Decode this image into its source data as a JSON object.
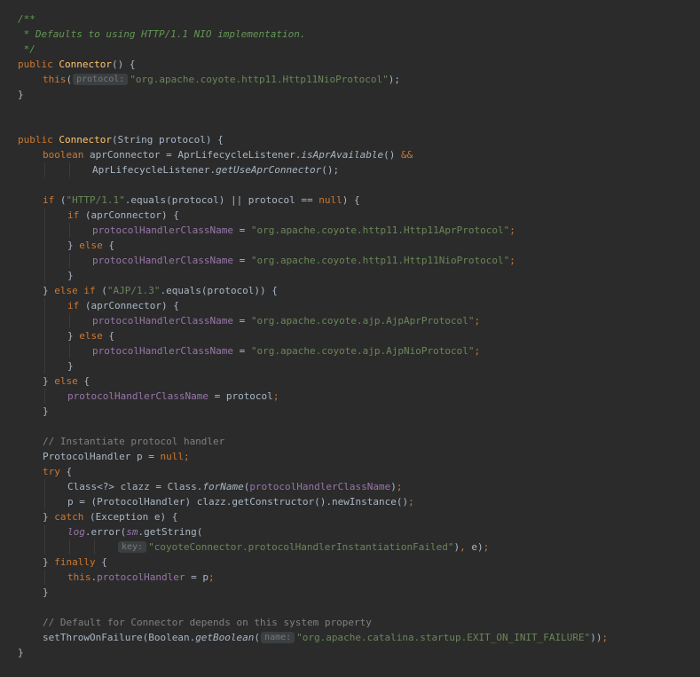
{
  "editor": {
    "lines": [
      {
        "indent": 0,
        "tokens": [
          {
            "t": "/**",
            "c": "doc"
          }
        ]
      },
      {
        "indent": 0,
        "tokens": [
          {
            "t": " * Defaults to using HTTP/1.1 NIO implementation.",
            "c": "doc"
          }
        ]
      },
      {
        "indent": 0,
        "tokens": [
          {
            "t": " */",
            "c": "doc"
          }
        ]
      },
      {
        "indent": 0,
        "tokens": [
          {
            "t": "public ",
            "c": "kw"
          },
          {
            "t": "Connector",
            "c": "fn"
          },
          {
            "t": "() {",
            "c": "plain"
          }
        ]
      },
      {
        "indent": 1,
        "tokens": [
          {
            "t": "this",
            "c": "kw"
          },
          {
            "t": "(",
            "c": "plain"
          },
          {
            "t": "protocol:",
            "c": "hint"
          },
          {
            "t": "\"org.apache.coyote.http11.Http11NioProtocol\"",
            "c": "str"
          },
          {
            "t": ");",
            "c": "plain"
          }
        ]
      },
      {
        "indent": 0,
        "tokens": [
          {
            "t": "}",
            "c": "plain"
          }
        ]
      },
      {
        "indent": 0,
        "tokens": []
      },
      {
        "indent": 0,
        "tokens": []
      },
      {
        "indent": 0,
        "tokens": [
          {
            "t": "public ",
            "c": "kw"
          },
          {
            "t": "Connector",
            "c": "fn"
          },
          {
            "t": "(String protocol) {",
            "c": "plain"
          }
        ]
      },
      {
        "indent": 1,
        "tokens": [
          {
            "t": "boolean ",
            "c": "kw"
          },
          {
            "t": "aprConnector = AprLifecycleListener.",
            "c": "plain"
          },
          {
            "t": "isAprAvailable",
            "c": "italic"
          },
          {
            "t": "() ",
            "c": "plain"
          },
          {
            "t": "&&",
            "c": "kw"
          }
        ]
      },
      {
        "indent": 3,
        "tokens": [
          {
            "t": "AprLifecycleListener.",
            "c": "plain"
          },
          {
            "t": "getUseAprConnector",
            "c": "italic"
          },
          {
            "t": "();",
            "c": "plain"
          }
        ]
      },
      {
        "indent": 0,
        "tokens": []
      },
      {
        "indent": 1,
        "tokens": [
          {
            "t": "if ",
            "c": "kw"
          },
          {
            "t": "(",
            "c": "plain"
          },
          {
            "t": "\"HTTP/1.1\"",
            "c": "str"
          },
          {
            "t": ".equals(protocol) || protocol == ",
            "c": "plain"
          },
          {
            "t": "null",
            "c": "kw"
          },
          {
            "t": ") {",
            "c": "plain"
          }
        ]
      },
      {
        "indent": 2,
        "tokens": [
          {
            "t": "if ",
            "c": "kw"
          },
          {
            "t": "(aprConnector) {",
            "c": "plain"
          }
        ]
      },
      {
        "indent": 3,
        "tokens": [
          {
            "t": "protocolHandlerClassName",
            "c": "field"
          },
          {
            "t": " = ",
            "c": "plain"
          },
          {
            "t": "\"org.apache.coyote.http11.Http11AprProtocol\"",
            "c": "str"
          },
          {
            "t": ";",
            "c": "kw"
          }
        ]
      },
      {
        "indent": 2,
        "tokens": [
          {
            "t": "} ",
            "c": "plain"
          },
          {
            "t": "else ",
            "c": "kw"
          },
          {
            "t": "{",
            "c": "plain"
          }
        ]
      },
      {
        "indent": 3,
        "tokens": [
          {
            "t": "protocolHandlerClassName",
            "c": "field"
          },
          {
            "t": " = ",
            "c": "plain"
          },
          {
            "t": "\"org.apache.coyote.http11.Http11NioProtocol\"",
            "c": "str"
          },
          {
            "t": ";",
            "c": "kw"
          }
        ]
      },
      {
        "indent": 2,
        "tokens": [
          {
            "t": "}",
            "c": "plain"
          }
        ]
      },
      {
        "indent": 1,
        "tokens": [
          {
            "t": "} ",
            "c": "plain"
          },
          {
            "t": "else if ",
            "c": "kw"
          },
          {
            "t": "(",
            "c": "plain"
          },
          {
            "t": "\"AJP/1.3\"",
            "c": "str"
          },
          {
            "t": ".equals(protocol)) {",
            "c": "plain"
          }
        ]
      },
      {
        "indent": 2,
        "tokens": [
          {
            "t": "if ",
            "c": "kw"
          },
          {
            "t": "(aprConnector) {",
            "c": "plain"
          }
        ]
      },
      {
        "indent": 3,
        "tokens": [
          {
            "t": "protocolHandlerClassName",
            "c": "field"
          },
          {
            "t": " = ",
            "c": "plain"
          },
          {
            "t": "\"org.apache.coyote.ajp.AjpAprProtocol\"",
            "c": "str"
          },
          {
            "t": ";",
            "c": "kw"
          }
        ]
      },
      {
        "indent": 2,
        "tokens": [
          {
            "t": "} ",
            "c": "plain"
          },
          {
            "t": "else ",
            "c": "kw"
          },
          {
            "t": "{",
            "c": "plain"
          }
        ]
      },
      {
        "indent": 3,
        "tokens": [
          {
            "t": "protocolHandlerClassName",
            "c": "field"
          },
          {
            "t": " = ",
            "c": "plain"
          },
          {
            "t": "\"org.apache.coyote.ajp.AjpNioProtocol\"",
            "c": "str"
          },
          {
            "t": ";",
            "c": "kw"
          }
        ]
      },
      {
        "indent": 2,
        "tokens": [
          {
            "t": "}",
            "c": "plain"
          }
        ]
      },
      {
        "indent": 1,
        "tokens": [
          {
            "t": "} ",
            "c": "plain"
          },
          {
            "t": "else ",
            "c": "kw"
          },
          {
            "t": "{",
            "c": "plain"
          }
        ]
      },
      {
        "indent": 2,
        "tokens": [
          {
            "t": "protocolHandlerClassName",
            "c": "field"
          },
          {
            "t": " = protocol",
            "c": "plain"
          },
          {
            "t": ";",
            "c": "kw"
          }
        ]
      },
      {
        "indent": 1,
        "tokens": [
          {
            "t": "}",
            "c": "plain"
          }
        ]
      },
      {
        "indent": 0,
        "tokens": []
      },
      {
        "indent": 1,
        "tokens": [
          {
            "t": "// Instantiate protocol handler",
            "c": "comment"
          }
        ]
      },
      {
        "indent": 1,
        "tokens": [
          {
            "t": "ProtocolHandler p = ",
            "c": "plain"
          },
          {
            "t": "null;",
            "c": "kw"
          }
        ]
      },
      {
        "indent": 1,
        "tokens": [
          {
            "t": "try ",
            "c": "kw"
          },
          {
            "t": "{",
            "c": "plain"
          }
        ]
      },
      {
        "indent": 2,
        "tokens": [
          {
            "t": "Class<?> clazz = Class.",
            "c": "plain"
          },
          {
            "t": "forName",
            "c": "italic"
          },
          {
            "t": "(",
            "c": "plain"
          },
          {
            "t": "protocolHandlerClassName",
            "c": "field"
          },
          {
            "t": ")",
            "c": "plain"
          },
          {
            "t": ";",
            "c": "kw"
          }
        ]
      },
      {
        "indent": 2,
        "tokens": [
          {
            "t": "p = (ProtocolHandler) clazz.getConstructor().newInstance()",
            "c": "plain"
          },
          {
            "t": ";",
            "c": "kw"
          }
        ]
      },
      {
        "indent": 1,
        "tokens": [
          {
            "t": "} ",
            "c": "plain"
          },
          {
            "t": "catch ",
            "c": "kw"
          },
          {
            "t": "(Exception e) {",
            "c": "plain"
          }
        ]
      },
      {
        "indent": 2,
        "tokens": [
          {
            "t": "log",
            "c": "static"
          },
          {
            "t": ".error(",
            "c": "plain"
          },
          {
            "t": "sm",
            "c": "static"
          },
          {
            "t": ".getString(",
            "c": "plain"
          }
        ]
      },
      {
        "indent": 4,
        "tokens": [
          {
            "t": "key:",
            "c": "hint"
          },
          {
            "t": "\"coyoteConnector.protocolHandlerInstantiationFailed\"",
            "c": "str"
          },
          {
            "t": ")",
            "c": "plain"
          },
          {
            "t": ", ",
            "c": "kw"
          },
          {
            "t": "e)",
            "c": "plain"
          },
          {
            "t": ";",
            "c": "kw"
          }
        ]
      },
      {
        "indent": 1,
        "tokens": [
          {
            "t": "} ",
            "c": "plain"
          },
          {
            "t": "finally ",
            "c": "kw"
          },
          {
            "t": "{",
            "c": "plain"
          }
        ]
      },
      {
        "indent": 2,
        "tokens": [
          {
            "t": "this",
            "c": "kw"
          },
          {
            "t": ".",
            "c": "plain"
          },
          {
            "t": "protocolHandler",
            "c": "field"
          },
          {
            "t": " = p",
            "c": "plain"
          },
          {
            "t": ";",
            "c": "kw"
          }
        ]
      },
      {
        "indent": 1,
        "tokens": [
          {
            "t": "}",
            "c": "plain"
          }
        ]
      },
      {
        "indent": 0,
        "tokens": []
      },
      {
        "indent": 1,
        "tokens": [
          {
            "t": "// Default for Connector depends on this system property",
            "c": "comment"
          }
        ]
      },
      {
        "indent": 1,
        "tokens": [
          {
            "t": "setThrowOnFailure(Boolean.",
            "c": "plain"
          },
          {
            "t": "getBoolean",
            "c": "italic"
          },
          {
            "t": "(",
            "c": "plain"
          },
          {
            "t": "name:",
            "c": "hint"
          },
          {
            "t": "\"org.apache.catalina.startup.EXIT_ON_INIT_FAILURE\"",
            "c": "str"
          },
          {
            "t": "))",
            "c": "plain"
          },
          {
            "t": ";",
            "c": "kw"
          }
        ]
      },
      {
        "indent": 0,
        "tokens": [
          {
            "t": "}",
            "c": "plain"
          }
        ]
      }
    ]
  },
  "colors": {
    "background": "#2b2b2b",
    "keyword": "#cc7832",
    "string": "#6a8759",
    "method_declaration": "#ffc66d",
    "field": "#9876aa",
    "comment": "#808080",
    "doc_comment": "#629755",
    "text": "#a9b7c6"
  }
}
